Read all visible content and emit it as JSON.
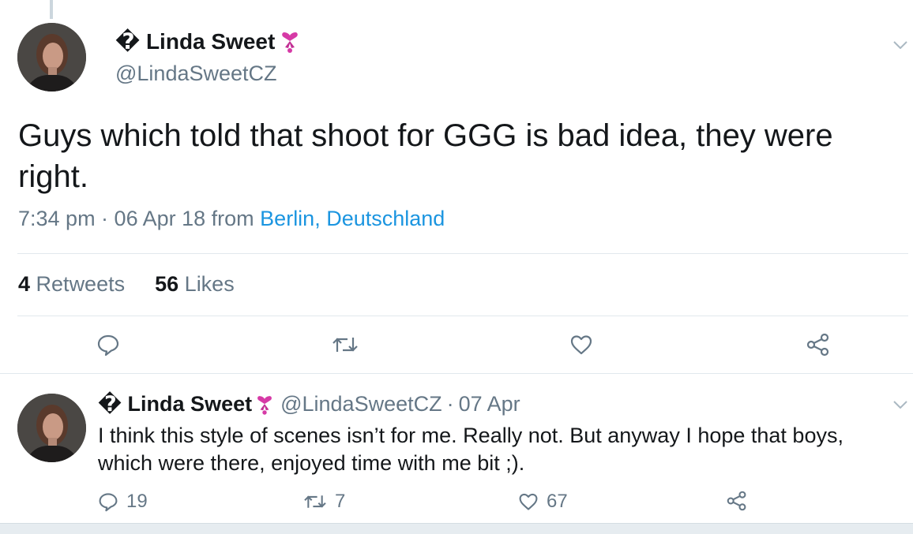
{
  "main_tweet": {
    "name": "� Linda Sweet",
    "name_emoji": "ribbon-heart-icon",
    "handle": "@LindaSweetCZ",
    "text": "Guys which told that shoot for GGG is bad idea, they were right.",
    "time": "7:34 pm · 06 Apr 18 from",
    "location": "Berlin, Deutschland",
    "retweets_count": "4",
    "retweets_label": "Retweets",
    "likes_count": "56",
    "likes_label": "Likes",
    "actions": [
      "reply-icon",
      "retweet-icon",
      "like-icon",
      "share-icon"
    ]
  },
  "reply_tweet": {
    "name": "� Linda Sweet",
    "handle": "@LindaSweetCZ",
    "separator": "·",
    "date": "07 Apr",
    "text": "I think this style of scenes isn’t for me. Really not. But anyway I hope that boys, which were there, enjoyed time with me bit ;).",
    "reply_count": "19",
    "retweet_count": "7",
    "like_count": "67"
  },
  "colors": {
    "text": "#14171a",
    "secondary": "#657786",
    "link": "#1b95e0",
    "divider": "#e1e8ed",
    "emoji": "#d63aa6"
  }
}
